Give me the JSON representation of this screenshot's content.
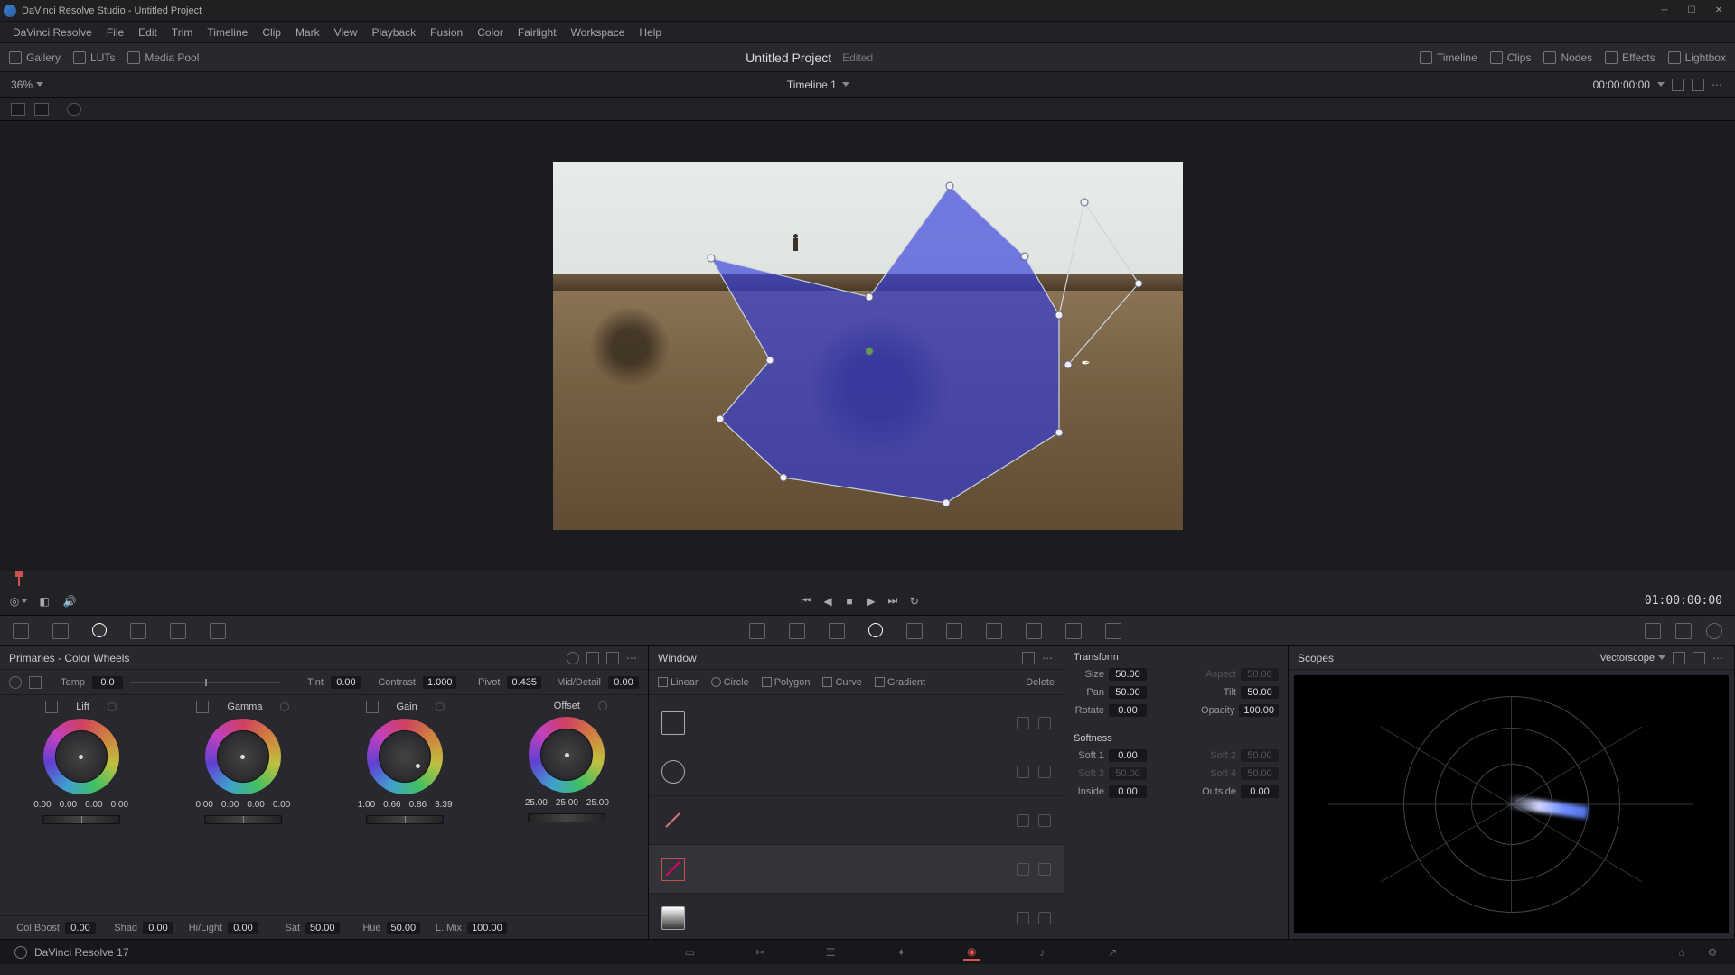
{
  "titlebar": {
    "app": "DaVinci Resolve Studio",
    "project": "Untitled Project"
  },
  "menu": [
    "DaVinci Resolve",
    "File",
    "Edit",
    "Trim",
    "Timeline",
    "Clip",
    "Mark",
    "View",
    "Playback",
    "Fusion",
    "Color",
    "Fairlight",
    "Workspace",
    "Help"
  ],
  "top": {
    "left": [
      "Gallery",
      "LUTs",
      "Media Pool"
    ],
    "project": "Untitled Project",
    "edited": "Edited",
    "right": [
      "Timeline",
      "Clips",
      "Nodes",
      "Effects",
      "Lightbox"
    ]
  },
  "viewer": {
    "zoom": "36%",
    "timeline": "Timeline 1",
    "tc": "00:00:00:00"
  },
  "transport": {
    "tc": "01:00:00:00"
  },
  "primaries": {
    "title": "Primaries - Color Wheels",
    "adjustments": [
      {
        "label": "Temp",
        "val": "0.0"
      },
      {
        "label": "Tint",
        "val": "0.00"
      },
      {
        "label": "Contrast",
        "val": "1.000"
      },
      {
        "label": "Pivot",
        "val": "0.435"
      },
      {
        "label": "Mid/Detail",
        "val": "0.00"
      }
    ],
    "wheels": [
      {
        "name": "Lift",
        "vals": [
          "0.00",
          "0.00",
          "0.00",
          "0.00"
        ]
      },
      {
        "name": "Gamma",
        "vals": [
          "0.00",
          "0.00",
          "0.00",
          "0.00"
        ]
      },
      {
        "name": "Gain",
        "vals": [
          "1.00",
          "0.66",
          "0.86",
          "3.39"
        ]
      },
      {
        "name": "Offset",
        "vals": [
          "25.00",
          "25.00",
          "25.00"
        ]
      }
    ],
    "bottom": [
      {
        "label": "Col Boost",
        "val": "0.00"
      },
      {
        "label": "Shad",
        "val": "0.00"
      },
      {
        "label": "Hi/Light",
        "val": "0.00"
      },
      {
        "label": "Sat",
        "val": "50.00"
      },
      {
        "label": "Hue",
        "val": "50.00"
      },
      {
        "label": "L. Mix",
        "val": "100.00"
      }
    ]
  },
  "window": {
    "title": "Window",
    "tools": [
      "Linear",
      "Circle",
      "Polygon",
      "Curve",
      "Gradient",
      "Delete"
    ]
  },
  "transform": {
    "title": "Transform",
    "size": "50.00",
    "aspect": "50.00",
    "pan": "50.00",
    "tilt": "50.00",
    "rotate": "0.00",
    "opacity": "100.00",
    "softness": "Softness",
    "soft1": "0.00",
    "soft2": "50.00",
    "soft3": "50.00",
    "soft4": "50.00",
    "inside": "0.00",
    "outside": "0.00"
  },
  "scopes": {
    "title": "Scopes",
    "mode": "Vectorscope"
  },
  "footer": {
    "version": "DaVinci Resolve 17"
  }
}
